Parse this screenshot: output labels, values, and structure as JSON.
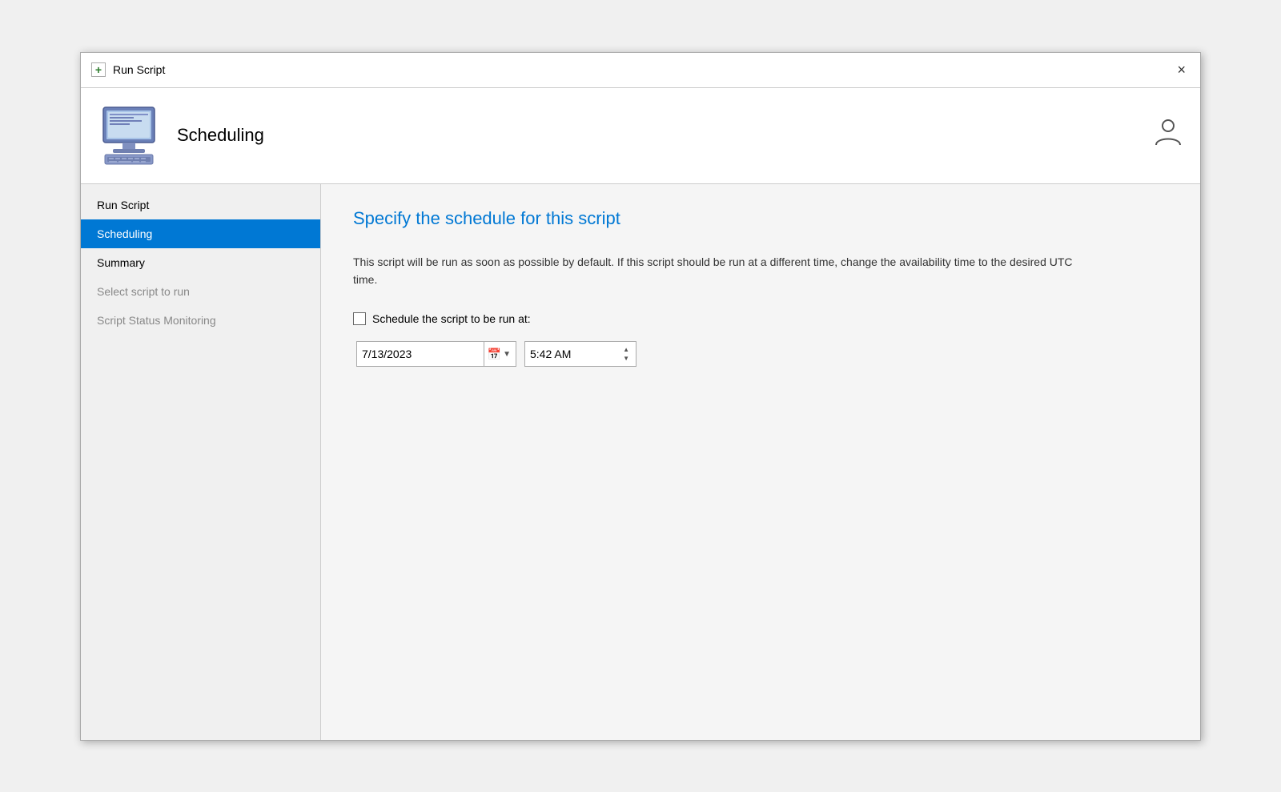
{
  "titleBar": {
    "icon": "+",
    "title": "Run Script",
    "closeLabel": "×"
  },
  "header": {
    "title": "Scheduling",
    "helpIconLabel": "?"
  },
  "sidebar": {
    "items": [
      {
        "id": "run-script",
        "label": "Run Script",
        "state": "normal"
      },
      {
        "id": "scheduling",
        "label": "Scheduling",
        "state": "active"
      },
      {
        "id": "summary",
        "label": "Summary",
        "state": "normal"
      },
      {
        "id": "select-script",
        "label": "Select script to run",
        "state": "disabled"
      },
      {
        "id": "script-status",
        "label": "Script Status Monitoring",
        "state": "disabled"
      }
    ]
  },
  "content": {
    "title": "Specify the schedule for this script",
    "description": "This script will be run as soon as possible by default. If this script should be run at a different time, change the availability time to the desired UTC time.",
    "scheduleCheckboxLabel": "Schedule the script to be run at:",
    "dateValue": "7/13/2023",
    "timeValue": "5:42 AM",
    "datePlaceholder": "7/13/2023",
    "timePlaceholder": "5:42 AM"
  }
}
